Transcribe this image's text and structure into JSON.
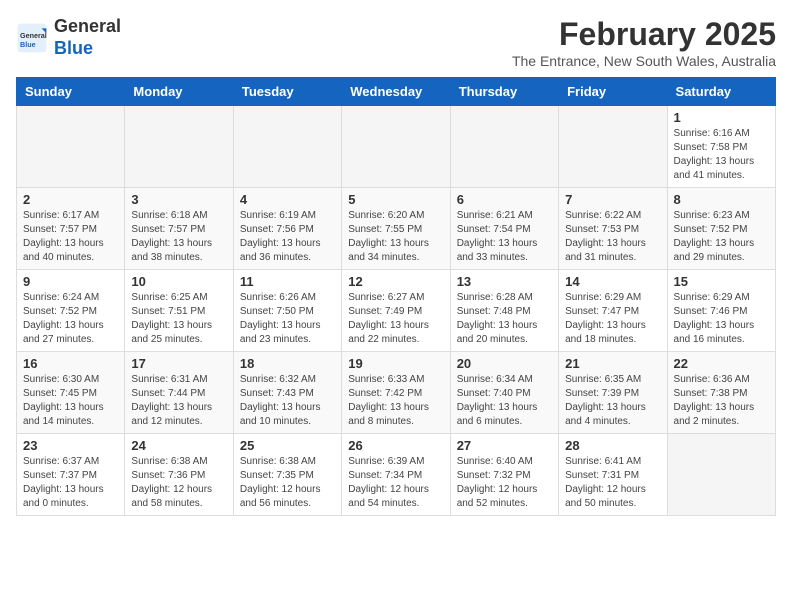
{
  "logo": {
    "general": "General",
    "blue": "Blue"
  },
  "header": {
    "month_title": "February 2025",
    "subtitle": "The Entrance, New South Wales, Australia"
  },
  "weekdays": [
    "Sunday",
    "Monday",
    "Tuesday",
    "Wednesday",
    "Thursday",
    "Friday",
    "Saturday"
  ],
  "weeks": [
    [
      {
        "day": "",
        "info": ""
      },
      {
        "day": "",
        "info": ""
      },
      {
        "day": "",
        "info": ""
      },
      {
        "day": "",
        "info": ""
      },
      {
        "day": "",
        "info": ""
      },
      {
        "day": "",
        "info": ""
      },
      {
        "day": "1",
        "info": "Sunrise: 6:16 AM\nSunset: 7:58 PM\nDaylight: 13 hours\nand 41 minutes."
      }
    ],
    [
      {
        "day": "2",
        "info": "Sunrise: 6:17 AM\nSunset: 7:57 PM\nDaylight: 13 hours\nand 40 minutes."
      },
      {
        "day": "3",
        "info": "Sunrise: 6:18 AM\nSunset: 7:57 PM\nDaylight: 13 hours\nand 38 minutes."
      },
      {
        "day": "4",
        "info": "Sunrise: 6:19 AM\nSunset: 7:56 PM\nDaylight: 13 hours\nand 36 minutes."
      },
      {
        "day": "5",
        "info": "Sunrise: 6:20 AM\nSunset: 7:55 PM\nDaylight: 13 hours\nand 34 minutes."
      },
      {
        "day": "6",
        "info": "Sunrise: 6:21 AM\nSunset: 7:54 PM\nDaylight: 13 hours\nand 33 minutes."
      },
      {
        "day": "7",
        "info": "Sunrise: 6:22 AM\nSunset: 7:53 PM\nDaylight: 13 hours\nand 31 minutes."
      },
      {
        "day": "8",
        "info": "Sunrise: 6:23 AM\nSunset: 7:52 PM\nDaylight: 13 hours\nand 29 minutes."
      }
    ],
    [
      {
        "day": "9",
        "info": "Sunrise: 6:24 AM\nSunset: 7:52 PM\nDaylight: 13 hours\nand 27 minutes."
      },
      {
        "day": "10",
        "info": "Sunrise: 6:25 AM\nSunset: 7:51 PM\nDaylight: 13 hours\nand 25 minutes."
      },
      {
        "day": "11",
        "info": "Sunrise: 6:26 AM\nSunset: 7:50 PM\nDaylight: 13 hours\nand 23 minutes."
      },
      {
        "day": "12",
        "info": "Sunrise: 6:27 AM\nSunset: 7:49 PM\nDaylight: 13 hours\nand 22 minutes."
      },
      {
        "day": "13",
        "info": "Sunrise: 6:28 AM\nSunset: 7:48 PM\nDaylight: 13 hours\nand 20 minutes."
      },
      {
        "day": "14",
        "info": "Sunrise: 6:29 AM\nSunset: 7:47 PM\nDaylight: 13 hours\nand 18 minutes."
      },
      {
        "day": "15",
        "info": "Sunrise: 6:29 AM\nSunset: 7:46 PM\nDaylight: 13 hours\nand 16 minutes."
      }
    ],
    [
      {
        "day": "16",
        "info": "Sunrise: 6:30 AM\nSunset: 7:45 PM\nDaylight: 13 hours\nand 14 minutes."
      },
      {
        "day": "17",
        "info": "Sunrise: 6:31 AM\nSunset: 7:44 PM\nDaylight: 13 hours\nand 12 minutes."
      },
      {
        "day": "18",
        "info": "Sunrise: 6:32 AM\nSunset: 7:43 PM\nDaylight: 13 hours\nand 10 minutes."
      },
      {
        "day": "19",
        "info": "Sunrise: 6:33 AM\nSunset: 7:42 PM\nDaylight: 13 hours\nand 8 minutes."
      },
      {
        "day": "20",
        "info": "Sunrise: 6:34 AM\nSunset: 7:40 PM\nDaylight: 13 hours\nand 6 minutes."
      },
      {
        "day": "21",
        "info": "Sunrise: 6:35 AM\nSunset: 7:39 PM\nDaylight: 13 hours\nand 4 minutes."
      },
      {
        "day": "22",
        "info": "Sunrise: 6:36 AM\nSunset: 7:38 PM\nDaylight: 13 hours\nand 2 minutes."
      }
    ],
    [
      {
        "day": "23",
        "info": "Sunrise: 6:37 AM\nSunset: 7:37 PM\nDaylight: 13 hours\nand 0 minutes."
      },
      {
        "day": "24",
        "info": "Sunrise: 6:38 AM\nSunset: 7:36 PM\nDaylight: 12 hours\nand 58 minutes."
      },
      {
        "day": "25",
        "info": "Sunrise: 6:38 AM\nSunset: 7:35 PM\nDaylight: 12 hours\nand 56 minutes."
      },
      {
        "day": "26",
        "info": "Sunrise: 6:39 AM\nSunset: 7:34 PM\nDaylight: 12 hours\nand 54 minutes."
      },
      {
        "day": "27",
        "info": "Sunrise: 6:40 AM\nSunset: 7:32 PM\nDaylight: 12 hours\nand 52 minutes."
      },
      {
        "day": "28",
        "info": "Sunrise: 6:41 AM\nSunset: 7:31 PM\nDaylight: 12 hours\nand 50 minutes."
      },
      {
        "day": "",
        "info": ""
      }
    ]
  ]
}
